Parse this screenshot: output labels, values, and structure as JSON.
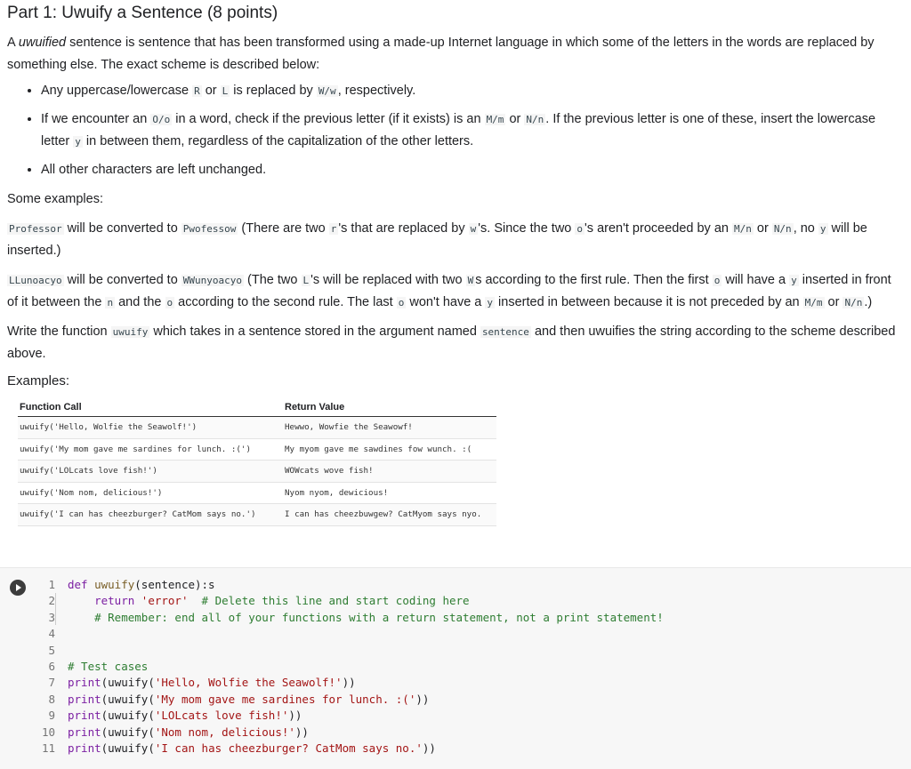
{
  "title": "Part 1: Uwuify a Sentence (8 points)",
  "intro": {
    "a": "A ",
    "b": "uwuified",
    "c": " sentence is sentence that has been transformed using a made-up Internet language in which some of the letters in the words are replaced by something else. The exact scheme is described below:"
  },
  "rules": {
    "r1": {
      "t1": "Any uppercase/lowercase ",
      "c1": "R",
      "t2": " or ",
      "c2": "L",
      "t3": " is replaced by ",
      "c3": "W/w",
      "t4": ", respectively."
    },
    "r2": {
      "t1": "If we encounter an ",
      "c1": "O/o",
      "t2": " in a word, check if the previous letter (if it exists) is an ",
      "c2": "M/m",
      "t3": " or ",
      "c3": "N/n",
      "t4": ". If the previous letter is one of these, insert the lowercase letter ",
      "c4": "y",
      "t5": " in between them, regardless of the capitalization of the other letters."
    },
    "r3": {
      "t1": "All other characters are left unchanged."
    }
  },
  "some_examples": "Some examples:",
  "ex1": {
    "c1": "Professor",
    "t1": " will be converted to ",
    "c2": "Pwofessow",
    "t2": " (There are two ",
    "c3": "r",
    "t3": "'s that are replaced by ",
    "c4": "w",
    "t4": "'s. Since the two ",
    "c5": "o",
    "t5": "'s aren't proceeded by an ",
    "c6": "M/n",
    "t6": " or ",
    "c7": "N/n",
    "t7": ", no ",
    "c8": "y",
    "t8": " will be inserted.)"
  },
  "ex2": {
    "c1": "LLunoacyo",
    "t1": " will be converted to ",
    "c2": "WWunyoacyo",
    "t2": " (The two ",
    "c3": "L",
    "t3": "'s will be replaced with two ",
    "c4": "W",
    "t4": "s according to the first rule. Then the first ",
    "c5": "o",
    "t5": " will have a ",
    "c6": "y",
    "t6": " inserted in front of it between the ",
    "c7": "n",
    "t7": " and the ",
    "c8": "o",
    "t8": " according to the second rule. The last ",
    "c9": "o",
    "t9": " won't have a ",
    "c10": "y",
    "t10": " inserted in between because it is not preceded by an ",
    "c11": "M/m",
    "t11": " or ",
    "c12": "N/n",
    "t12": ".)"
  },
  "write": {
    "t1": "Write the function ",
    "c1": "uwuify",
    "t2": " which takes in a sentence stored in the argument named ",
    "c2": "sentence",
    "t3": " and then uwuifies the string according to the scheme described above."
  },
  "examples_label": "Examples:",
  "table": {
    "headers": [
      "Function Call",
      "Return Value"
    ],
    "rows": [
      [
        "uwuify('Hello, Wolfie the Seawolf!')",
        "Hewwo, Wowfie the Seawowf!"
      ],
      [
        "uwuify('My mom gave me sardines for lunch. :(')",
        "My myom gave me sawdines fow wunch. :("
      ],
      [
        "uwuify('LOLcats love fish!')",
        "WOWcats wove fish!"
      ],
      [
        "uwuify('Nom nom, delicious!')",
        "Nyom nyom, dewicious!"
      ],
      [
        "uwuify('I can has cheezburger? CatMom says no.')",
        "I can has cheezbuwgew? CatMyom says nyo."
      ]
    ]
  },
  "code": {
    "line_numbers": [
      "1",
      "2",
      "3",
      "4",
      "5",
      "6",
      "7",
      "8",
      "9",
      "10",
      "11"
    ],
    "l1": {
      "kw": "def",
      "sp": " ",
      "fn": "uwuify",
      "rest": "(sentence):s"
    },
    "l2": {
      "ind": "    ",
      "kw": "return",
      "sp": " ",
      "str": "'error'",
      "sp2": "  ",
      "cm": "# Delete this line and start coding here"
    },
    "l3": {
      "ind": "    ",
      "cm": "# Remember: end all of your functions with a return statement, not a print statement!"
    },
    "l6": {
      "cm": "# Test cases"
    },
    "calls": [
      {
        "bi": "print",
        "o": "(uwuify(",
        "str": "'Hello, Wolfie the Seawolf!'",
        "c": "))"
      },
      {
        "bi": "print",
        "o": "(uwuify(",
        "str": "'My mom gave me sardines for lunch. :('",
        "c": "))"
      },
      {
        "bi": "print",
        "o": "(uwuify(",
        "str": "'LOLcats love fish!'",
        "c": "))"
      },
      {
        "bi": "print",
        "o": "(uwuify(",
        "str": "'Nom nom, delicious!'",
        "c": "))"
      },
      {
        "bi": "print",
        "o": "(uwuify(",
        "str": "'I can has cheezburger? CatMom says no.'",
        "c": "))"
      }
    ]
  }
}
